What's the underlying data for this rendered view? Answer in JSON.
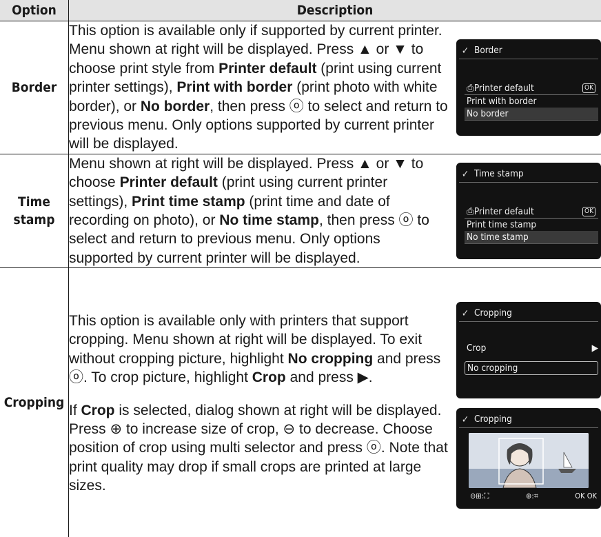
{
  "header": {
    "option": "Option",
    "description": "Description"
  },
  "rows": [
    {
      "option": "Border",
      "text": [
        "This option is available only if supported by current printer. Menu shown at right will be displayed. Press ▲ or ▼ to choose print style from ",
        "Printer default",
        " (print using current printer settings), ",
        "Print with border",
        " (print photo with white border), or ",
        "No border",
        ", then press ⓞ to select and return to previous menu. Only options supported by current printer will be displayed."
      ],
      "screen": {
        "title": "Border",
        "items": [
          "Printer default",
          "Print with border",
          "No border"
        ],
        "ok_label": "OK"
      }
    },
    {
      "option": "Time stamp",
      "text": [
        "Menu shown at right will be displayed. Press ▲ or ▼ to choose ",
        "Printer default",
        " (print using current printer settings), ",
        "Print time stamp",
        " (print time and date of recording on photo), or ",
        "No time stamp",
        ", then press ⓞ to select and return to previous menu. Only options supported by current printer will be displayed."
      ],
      "screen": {
        "title": "Time stamp",
        "items": [
          "Printer default",
          "Print time stamp",
          "No time stamp"
        ],
        "ok_label": "OK"
      }
    },
    {
      "option": "Cropping",
      "text1": [
        "This option is available only with printers that support cropping. Menu shown at right will be displayed. To exit without cropping picture, highlight ",
        "No cropping",
        " and press ⓞ. To crop picture, highlight ",
        "Crop",
        " and press ▶."
      ],
      "text2": [
        "If ",
        "Crop",
        " is selected, dialog shown at right will be displayed. Press ⊕ to increase size of crop, ⊖ to decrease. Choose position of crop using multi selector and press ⓞ. Note that print quality may drop if small crops are printed at large sizes."
      ],
      "screen1": {
        "title": "Cropping",
        "items": [
          "Crop",
          "No cropping"
        ]
      },
      "screen2": {
        "title": "Cropping",
        "footer": [
          "⊖⊞:⛶",
          "⊕:⌗",
          "OK OK"
        ]
      }
    }
  ]
}
